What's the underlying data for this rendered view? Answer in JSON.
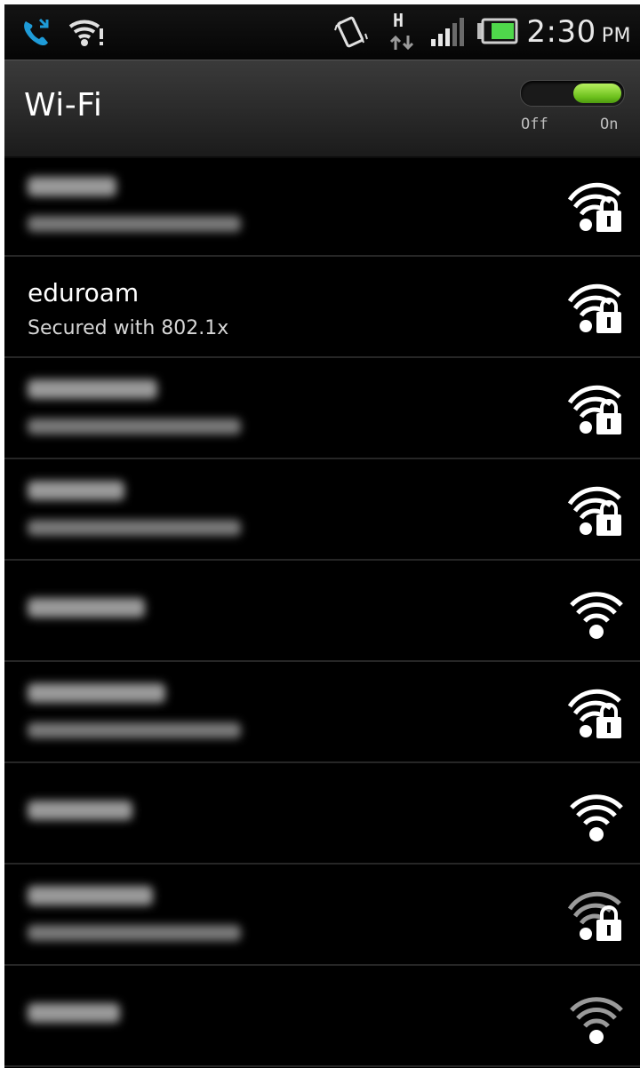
{
  "status_bar": {
    "icons": [
      "missed-call-icon",
      "wifi-alert-icon",
      "vibrate-icon",
      "hspa-data-icon",
      "signal-icon",
      "battery-icon"
    ],
    "time": "2:30",
    "ampm": "PM"
  },
  "header": {
    "title": "Wi-Fi",
    "toggle": {
      "off_label": "Off",
      "on_label": "On",
      "state": "on"
    }
  },
  "networks": [
    {
      "name": "",
      "subtitle": "",
      "secured": true,
      "signal": "strong",
      "blurred": true
    },
    {
      "name": "eduroam",
      "subtitle": "Secured with 802.1x",
      "secured": true,
      "signal": "strong",
      "blurred": false
    },
    {
      "name": "",
      "subtitle": "",
      "secured": true,
      "signal": "strong",
      "blurred": true
    },
    {
      "name": "",
      "subtitle": "",
      "secured": true,
      "signal": "strong",
      "blurred": true
    },
    {
      "name": "",
      "subtitle": "",
      "secured": false,
      "signal": "strong",
      "blurred": true
    },
    {
      "name": "",
      "subtitle": "",
      "secured": true,
      "signal": "strong",
      "blurred": true
    },
    {
      "name": "",
      "subtitle": "",
      "secured": false,
      "signal": "strong",
      "blurred": true
    },
    {
      "name": "",
      "subtitle": "",
      "secured": true,
      "signal": "weak",
      "blurred": true
    },
    {
      "name": "",
      "subtitle": "",
      "secured": false,
      "signal": "weak",
      "blurred": true
    }
  ],
  "colors": {
    "background": "#000000",
    "toggle_on": "#7ccc22",
    "text": "#ffffff"
  }
}
